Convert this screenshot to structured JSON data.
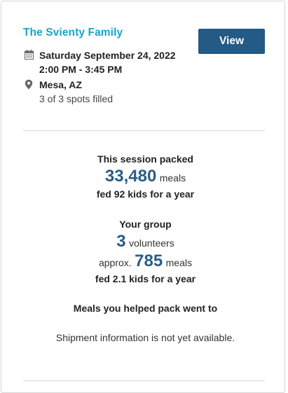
{
  "card": {
    "title": "The Svienty Family",
    "view_button_label": "View",
    "date": "Saturday September 24, 2022",
    "time": "2:00 PM - 3:45 PM",
    "location": "Mesa, AZ",
    "spots": "3 of 3 spots filled"
  },
  "session": {
    "heading": "This session packed",
    "meals_value": "33,480",
    "meals_unit": "meals",
    "fed_text": "fed 92 kids for a year"
  },
  "group": {
    "heading": "Your group",
    "volunteers_value": "3",
    "volunteers_unit": "volunteers",
    "approx_label": "approx.",
    "meals_value": "785",
    "meals_unit": "meals",
    "fed_text": "fed 2.1 kids for a year"
  },
  "shipment": {
    "heading": "Meals you helped pack went to",
    "status": "Shipment information is not yet available."
  },
  "colors": {
    "title": "#1aa5c8",
    "button": "#235a86",
    "numbers": "#2b5d86"
  },
  "icons": {
    "date": "calendar-icon",
    "location": "map-pin-icon"
  }
}
